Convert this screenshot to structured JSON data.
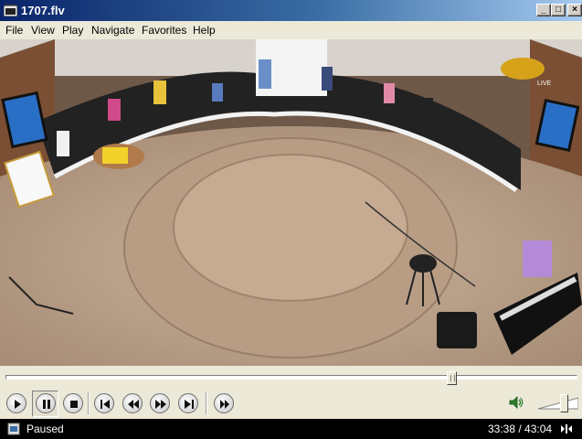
{
  "window": {
    "title": "1707.flv"
  },
  "caption_buttons": {
    "minimize": "_",
    "maximize": "□",
    "close": "×"
  },
  "menu": [
    "File",
    "View",
    "Play",
    "Navigate",
    "Favorites",
    "Help"
  ],
  "playback": {
    "position_fraction": 0.78,
    "volume_fraction": 0.72
  },
  "controls": [
    {
      "name": "play-icon"
    },
    {
      "name": "pause-icon"
    },
    {
      "name": "stop-icon"
    },
    {
      "name": "skip-back-icon"
    },
    {
      "name": "rewind-icon"
    },
    {
      "name": "fast-forward-icon"
    },
    {
      "name": "skip-forward-icon"
    },
    {
      "name": "frame-step-icon"
    }
  ],
  "status": {
    "text": "Paused",
    "time": "33:38 / 43:04"
  },
  "colors": {
    "title_start": "#0a246a",
    "title_end": "#a6caf0",
    "status_bg": "#000000",
    "chrome": "#ece9d8"
  },
  "video_overlays": {
    "logo_text": "LIVE"
  }
}
